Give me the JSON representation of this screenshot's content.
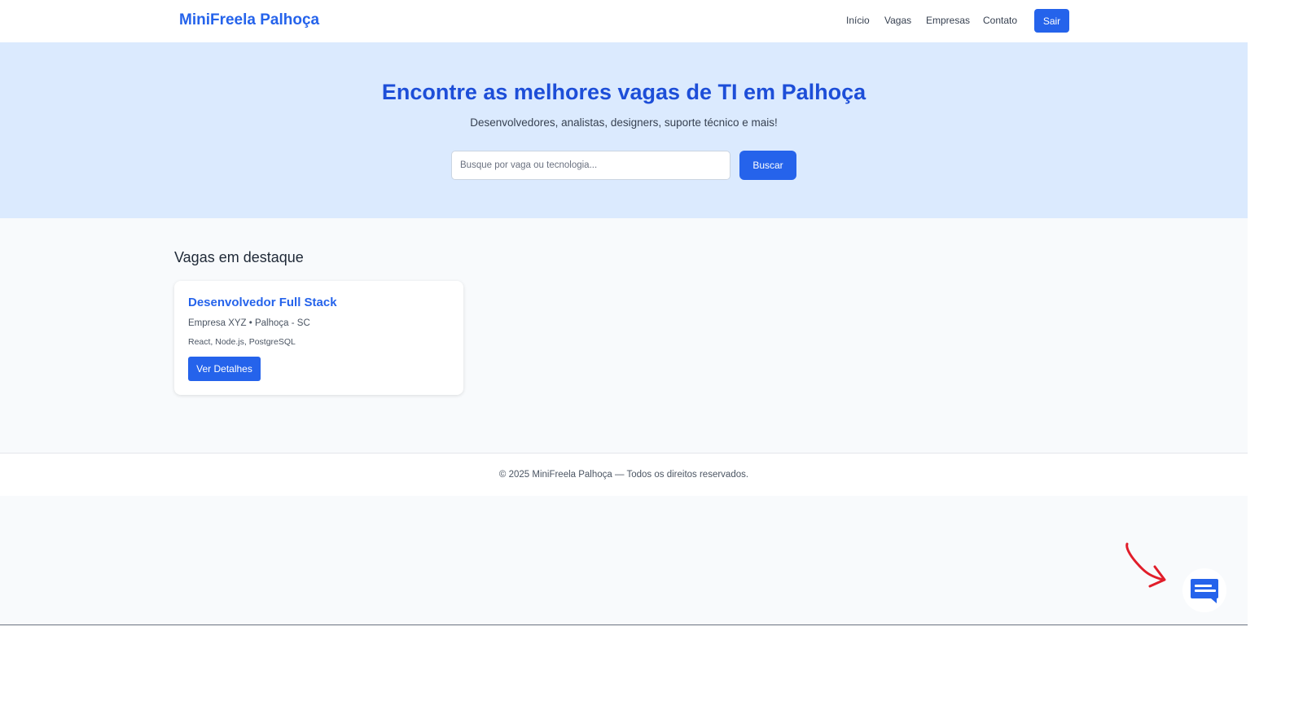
{
  "header": {
    "brand": "MiniFreela Palhoça",
    "nav": [
      {
        "label": "Início"
      },
      {
        "label": "Vagas"
      },
      {
        "label": "Empresas"
      },
      {
        "label": "Contato"
      }
    ],
    "logout_label": "Sair"
  },
  "hero": {
    "title": "Encontre as melhores vagas de TI em Palhoça",
    "subtitle": "Desenvolvedores, analistas, designers, suporte técnico e mais!",
    "search_placeholder": "Busque por vaga ou tecnologia...",
    "search_value": "",
    "search_button": "Buscar"
  },
  "featured": {
    "title": "Vagas em destaque",
    "jobs": [
      {
        "title": "Desenvolvedor Full Stack",
        "meta": "Empresa XYZ • Palhoça - SC",
        "tags": "React, Node.js, PostgreSQL",
        "button": "Ver Detalhes"
      }
    ]
  },
  "footer": {
    "text": "© 2025 MiniFreela Palhoça — Todos os direitos reservados."
  },
  "chat_widget": {
    "icon": "chat-bubble-icon",
    "annotation_icon": "red-arrow-icon"
  },
  "colors": {
    "primary": "#2563eb",
    "hero_bg": "#dbeafe",
    "page_bg": "#f8fafc",
    "annotation": "#e11d2a"
  }
}
